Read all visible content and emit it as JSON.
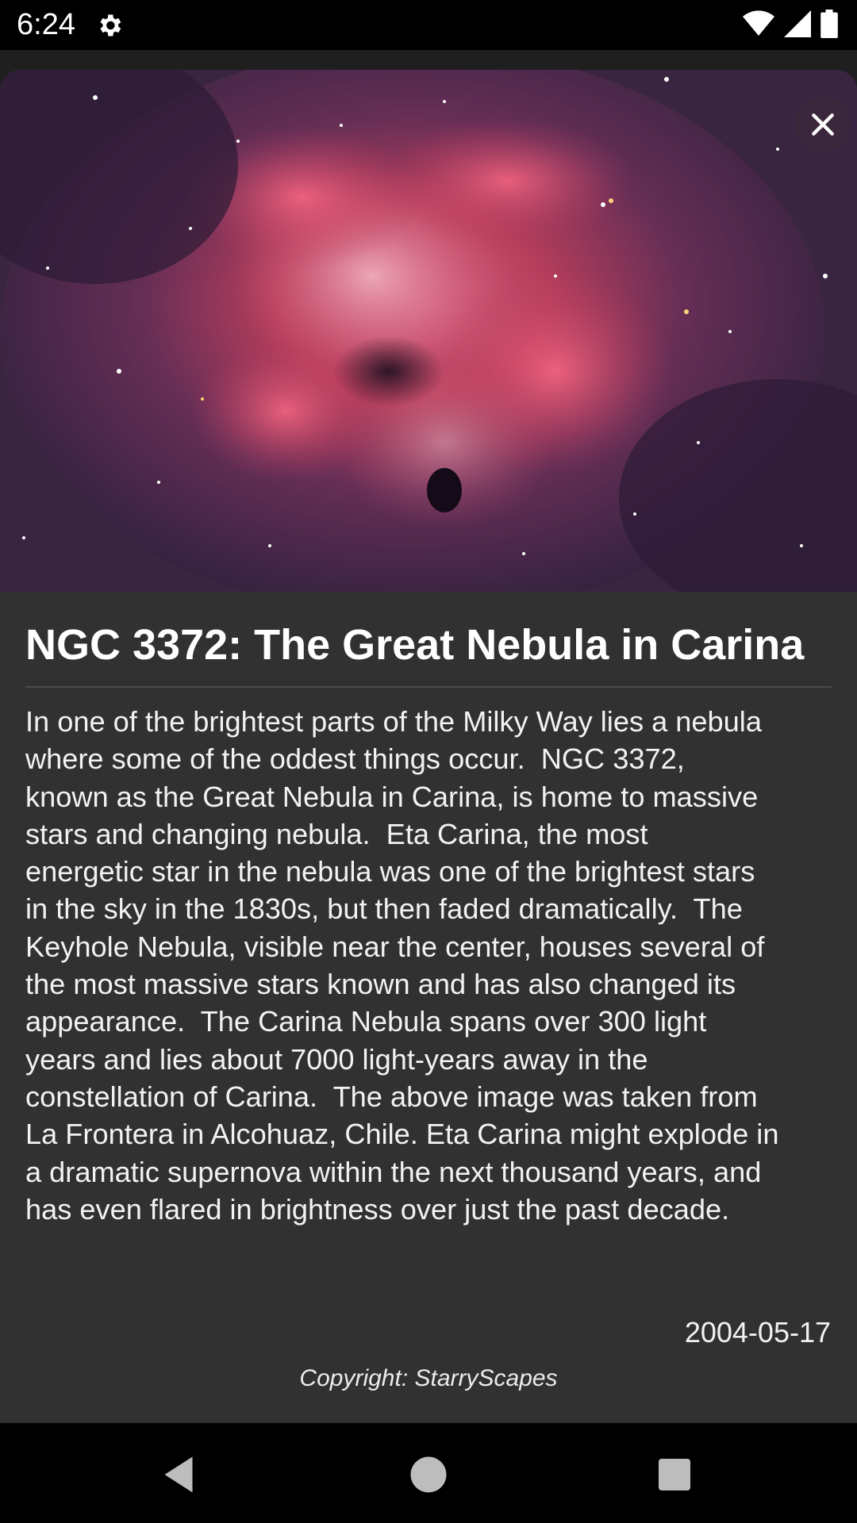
{
  "status_bar": {
    "time": "6:24",
    "icons": [
      "gear-icon",
      "wifi-icon",
      "signal-icon",
      "battery-icon"
    ]
  },
  "detail": {
    "image_alt": "NGC 3372 nebula image",
    "close_icon": "close-icon",
    "title": "NGC 3372: The Great Nebula in Carina",
    "description": "In one of the brightest parts of the Milky Way lies a nebula\nwhere some of the oddest things occur.  NGC 3372,\nknown as the Great Nebula in Carina, is home to massive\nstars and changing nebula.  Eta Carina, the most\nenergetic star in the nebula was one of the brightest stars\nin the sky in the 1830s, but then faded dramatically.  The\nKeyhole Nebula, visible near the center, houses several of\nthe most massive stars known and has also changed its\nappearance.  The Carina Nebula spans over 300 light\nyears and lies about 7000 light-years away in the\nconstellation of Carina.  The above image was taken from\nLa Frontera in Alcohuaz, Chile. Eta Carina might explode in\na dramatic supernova within the next thousand years, and\nhas even flared in brightness over just the past decade.",
    "date": "2004-05-17",
    "copyright": "Copyright: StarryScapes"
  },
  "nav_bar": {
    "buttons": [
      "back-icon",
      "home-icon",
      "recents-icon"
    ]
  },
  "colors": {
    "card_bg": "#313131",
    "nebula_pink": "#d9456a",
    "sky": "#3a2540"
  }
}
